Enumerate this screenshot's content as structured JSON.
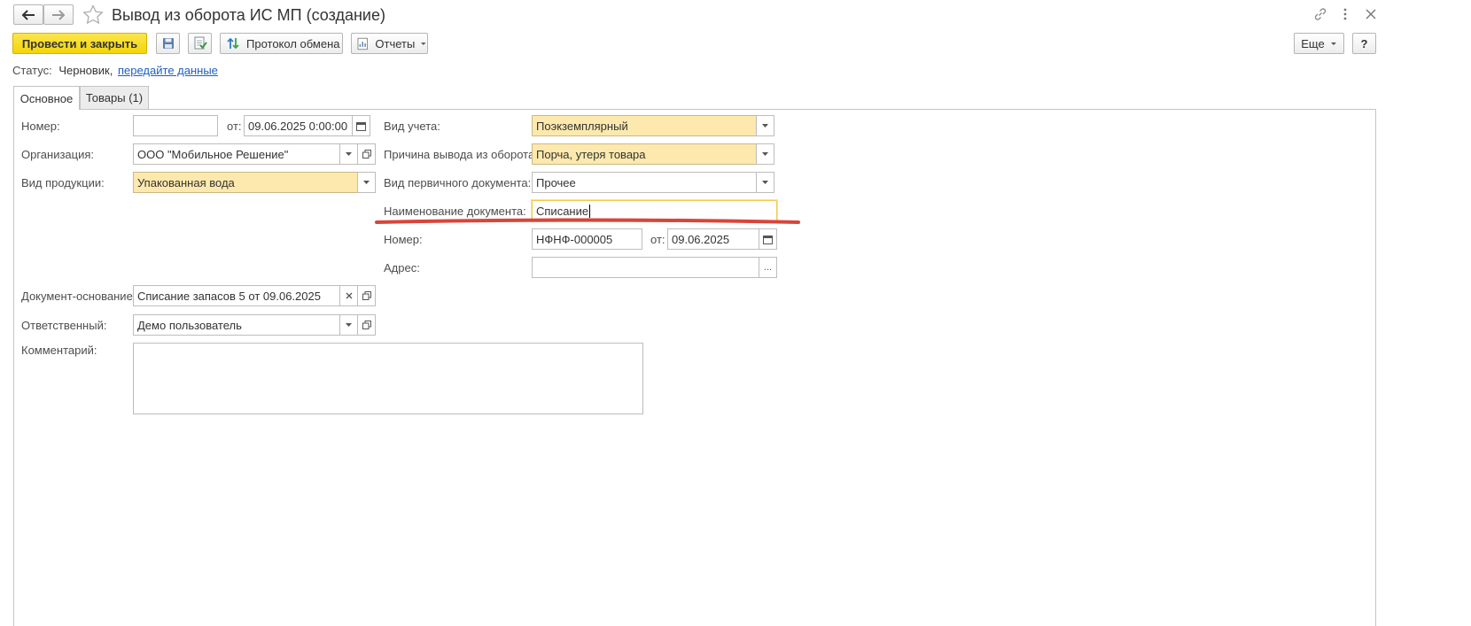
{
  "window": {
    "title": "Вывод из оборота ИС МП (создание)"
  },
  "toolbar": {
    "post_close": "Провести и закрыть",
    "exchange_protocol": "Протокол обмена",
    "reports": "Отчеты",
    "more": "Еще",
    "help": "?"
  },
  "status": {
    "label": "Статус:",
    "value": "Черновик,",
    "link": "передайте данные"
  },
  "tabs": [
    {
      "label": "Основное"
    },
    {
      "label": "Товары (1)"
    }
  ],
  "form": {
    "number": {
      "label": "Номер:",
      "value": ""
    },
    "date": {
      "label": "от:",
      "value": "09.06.2025  0:00:00"
    },
    "organization": {
      "label": "Организация:",
      "value": "ООО \"Мобильное Решение\""
    },
    "product_type": {
      "label": "Вид продукции:",
      "value": "Упакованная вода"
    },
    "accounting_type": {
      "label": "Вид учета:",
      "value": "Поэкземплярный"
    },
    "withdrawal_reason": {
      "label": "Причина вывода из оборота:",
      "value": "Порча, утеря товара"
    },
    "primary_doc_type": {
      "label": "Вид первичного документа:",
      "value": "Прочее"
    },
    "doc_name": {
      "label": "Наименование документа:",
      "value": "Списание"
    },
    "doc_number": {
      "label": "Номер:",
      "value": "НФНФ-000005"
    },
    "doc_date": {
      "label": "от:",
      "value": "09.06.2025"
    },
    "address": {
      "label": "Адрес:",
      "value": "",
      "choose": "..."
    },
    "base_document": {
      "label": "Документ-основание:",
      "value": "Списание запасов 5 от 09.06.2025"
    },
    "responsible": {
      "label": "Ответственный:",
      "value": "Демо пользователь"
    },
    "comment": {
      "label": "Комментарий:",
      "value": ""
    }
  },
  "colors": {
    "primary_button": "#f4d40a",
    "required_field": "#fde9ad",
    "link": "#1f5fbf",
    "annotation_underline": "#d9453a"
  }
}
